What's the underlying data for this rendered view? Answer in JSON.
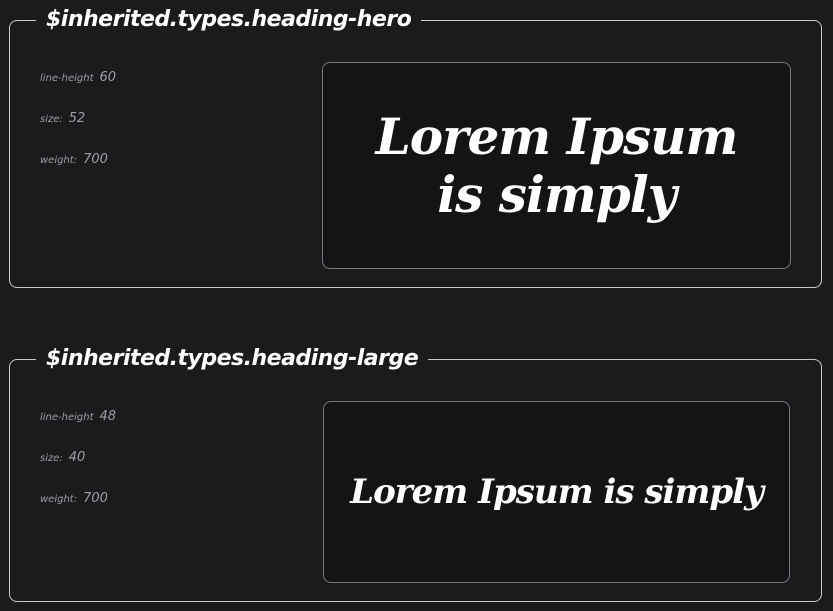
{
  "sections": [
    {
      "title": "$inherited.types.heading-hero",
      "properties": [
        {
          "label": "line-height",
          "value": "60"
        },
        {
          "label": "size:",
          "value": "52"
        },
        {
          "label": "weight:",
          "value": "700"
        }
      ],
      "preview_text": "Lorem Ipsum is simply"
    },
    {
      "title": "$inherited.types.heading-large",
      "properties": [
        {
          "label": "line-height",
          "value": "48"
        },
        {
          "label": "size:",
          "value": "40"
        },
        {
          "label": "weight:",
          "value": "700"
        }
      ],
      "preview_text": "Lorem Ipsum is simply"
    }
  ],
  "colors": {
    "background": "#1b1b1e",
    "card_border": "#c9c9cc",
    "preview_background": "#141416",
    "preview_border": "#77777d",
    "property_text": "#9c9ca3",
    "text": "#ffffff"
  }
}
